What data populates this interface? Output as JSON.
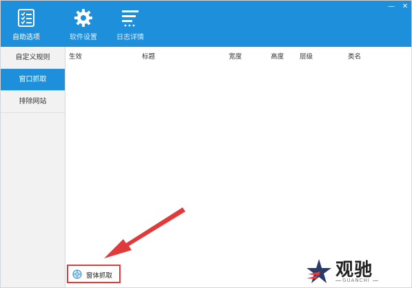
{
  "toolbar": {
    "items": [
      {
        "label": "自助选项",
        "icon": "checklist-icon"
      },
      {
        "label": "软件设置",
        "icon": "gear-icon"
      },
      {
        "label": "日志详情",
        "icon": "log-lines-icon"
      }
    ]
  },
  "window_controls": {
    "minimize": "—",
    "close": "✕"
  },
  "sidebar": {
    "items": [
      {
        "label": "自定义规则",
        "active": false
      },
      {
        "label": "窗口抓取",
        "active": true
      },
      {
        "label": "排除网站",
        "active": false
      }
    ]
  },
  "table": {
    "columns": [
      "生效",
      "标题",
      "宽度",
      "高度",
      "层级",
      "类名"
    ],
    "rows": []
  },
  "capture_button": {
    "label": "窗体抓取",
    "icon": "crosshair-icon"
  },
  "watermark": {
    "text_cn": "观驰",
    "text_en": "GUANCHI"
  },
  "colors": {
    "accent": "#1e8fdb",
    "highlight": "#e03a3a"
  }
}
